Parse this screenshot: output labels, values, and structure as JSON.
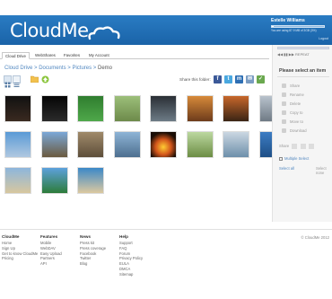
{
  "header": {
    "logo": "CloudMe",
    "user_name": "Estelle Williams",
    "quota_text": "You are using 87.9 MB of 3GB (3%)",
    "quota_percent": 3,
    "logout": "Logout",
    "brand_color": "#1f6db6"
  },
  "nav": {
    "tabs": [
      {
        "label": "Cloud Drive"
      },
      {
        "label": "WebShares"
      },
      {
        "label": "Favorites"
      },
      {
        "label": "My Account"
      }
    ]
  },
  "breadcrumb": {
    "items": [
      "Cloud Drive",
      "Documents",
      "Pictures"
    ],
    "current": "Demo",
    "separator": ">"
  },
  "toolbar": {
    "share_label": "Share this folder:",
    "share_icons": [
      {
        "name": "facebook",
        "letter": "f",
        "color": "#3b5998"
      },
      {
        "name": "twitter",
        "letter": "t",
        "color": "#4aa8e0"
      },
      {
        "name": "myspace",
        "letter": "m",
        "color": "#2e6fb4"
      },
      {
        "name": "email",
        "letter": "✉",
        "color": "#7a9cc2"
      },
      {
        "name": "checkmark",
        "letter": "✓",
        "color": "#6aa84f"
      }
    ]
  },
  "thumbnails": [
    {
      "alt": "dark scene",
      "bg": "linear-gradient(#111,#3a2a20)"
    },
    {
      "alt": "night lights",
      "bg": "linear-gradient(#050505,#2b2b2b)"
    },
    {
      "alt": "green leaf",
      "bg": "linear-gradient(#2f7d2f,#4fa84a)"
    },
    {
      "alt": "savanna",
      "bg": "linear-gradient(#9cbf7a,#6d8a4a)"
    },
    {
      "alt": "dark tree",
      "bg": "linear-gradient(#2a2f35,#6d7b86)"
    },
    {
      "alt": "orange tunnel",
      "bg": "linear-gradient(#d78a3a,#6d3b1b)"
    },
    {
      "alt": "sunset arches",
      "bg": "linear-gradient(#c8672b,#3a2414)"
    },
    {
      "alt": "skyscraper",
      "bg": "linear-gradient(#b8c2cc,#6f7a85)"
    },
    {
      "alt": "palm beach",
      "bg": "linear-gradient(#5a9ad6,#b0c8e0)"
    },
    {
      "alt": "rocky coast",
      "bg": "linear-gradient(#7ba8d8,#6b5a3f)"
    },
    {
      "alt": "stone ruins",
      "bg": "linear-gradient(#a08a6a,#5d4e3a)"
    },
    {
      "alt": "harbour",
      "bg": "linear-gradient(#8eb4d6,#4d6f8f)"
    },
    {
      "alt": "campfire",
      "bg": "radial-gradient(circle at 50% 60%, #ffcc33, #d2551b 40%, #1a0d05 75%)"
    },
    {
      "alt": "green field",
      "bg": "linear-gradient(#bcd8a0,#6c8d44)"
    },
    {
      "alt": "snowy lake",
      "bg": "linear-gradient(#cbd7e2,#6d8faa)"
    },
    {
      "alt": "blue waves",
      "bg": "linear-gradient(#3c7cc3,#1e4f86)"
    },
    {
      "alt": "beach dunes",
      "bg": "linear-gradient(#8db6dc,#d8c79f)"
    },
    {
      "alt": "palm trees",
      "bg": "linear-gradient(#5da1dd,#2d7c3a)"
    },
    {
      "alt": "tropical shore",
      "bg": "linear-gradient(#3b88c8,#dcc9a0)"
    }
  ],
  "side_panel": {
    "title": "Please select an item",
    "player_controls": "◀◀  ▮▮  ▶▶   REPEAT",
    "actions": [
      {
        "label": "Share"
      },
      {
        "label": "Rename"
      },
      {
        "label": "Delete"
      },
      {
        "label": "Copy to"
      },
      {
        "label": "Move to"
      },
      {
        "label": "Download"
      }
    ],
    "share_label": "Share",
    "multiple_select": "Multiple Select",
    "select_all": "Select all",
    "select_none": "Select none"
  },
  "footer": {
    "columns": [
      {
        "heading": "CloudMe",
        "links": [
          "Home",
          "Sign Up",
          "Get to know CloudMe",
          "Pricing"
        ]
      },
      {
        "heading": "Features",
        "links": [
          "Mobile",
          "WebDAV",
          "Easy Upload",
          "Partners",
          "API"
        ]
      },
      {
        "heading": "News",
        "links": [
          "Press kit",
          "Press coverage",
          "Facebook",
          "Twitter",
          "Blog"
        ]
      },
      {
        "heading": "Help",
        "links": [
          "Support",
          "FAQ",
          "Forum",
          "Privacy Policy",
          "EULA",
          "DMCA",
          "Sitemap"
        ]
      }
    ],
    "copyright": "© CloudMe 2012"
  }
}
